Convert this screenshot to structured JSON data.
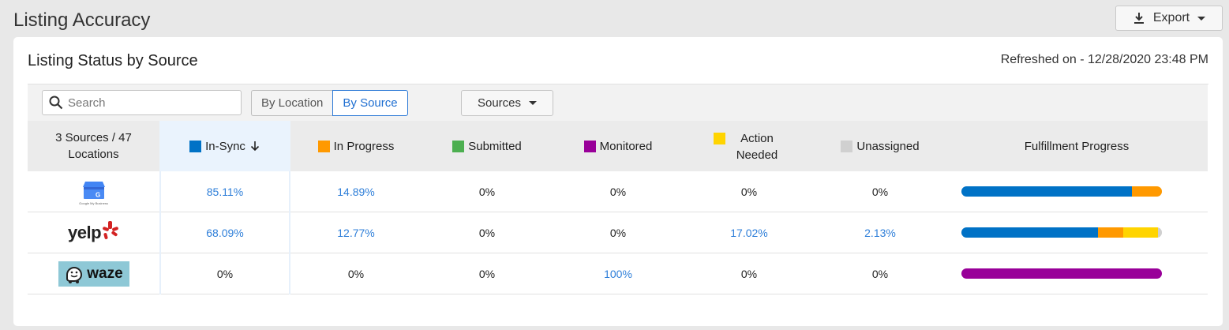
{
  "header": {
    "title": "Listing Accuracy",
    "export_label": "Export"
  },
  "card": {
    "title": "Listing Status by Source",
    "refreshed": "Refreshed on - 12/28/2020 23:48 PM"
  },
  "toolbar": {
    "search_placeholder": "Search",
    "toggle": {
      "by_location": "By Location",
      "by_source": "By Source",
      "active": "By Source"
    },
    "sources_label": "Sources"
  },
  "colors": {
    "in_sync": "#0072c6",
    "in_progress": "#ff9900",
    "submitted": "#4caf50",
    "monitored": "#990099",
    "action_needed": "#ffd400",
    "unassigned": "#d0d0d0",
    "link": "#2f7fd9"
  },
  "table": {
    "summary_label": "3 Sources / 47 Locations",
    "columns": {
      "in_sync": "In-Sync",
      "in_progress": "In Progress",
      "submitted": "Submitted",
      "monitored": "Monitored",
      "action_needed": "Action Needed",
      "unassigned": "Unassigned",
      "fulfillment": "Fulfillment Progress"
    },
    "sort": {
      "column": "In-Sync",
      "direction": "descending"
    },
    "rows": [
      {
        "source": "Google My Business",
        "logo_text": "Google My Business",
        "in_sync": "85.11%",
        "in_progress": "14.89%",
        "submitted": "0%",
        "monitored": "0%",
        "action_needed": "0%",
        "unassigned": "0%",
        "progress": {
          "in_sync": 85.11,
          "in_progress": 14.89,
          "submitted": 0,
          "monitored": 0,
          "action_needed": 0,
          "unassigned": 0
        }
      },
      {
        "source": "Yelp",
        "logo_text": "yelp",
        "in_sync": "68.09%",
        "in_progress": "12.77%",
        "submitted": "0%",
        "monitored": "0%",
        "action_needed": "17.02%",
        "unassigned": "2.13%",
        "progress": {
          "in_sync": 68.09,
          "in_progress": 12.77,
          "submitted": 0,
          "monitored": 0,
          "action_needed": 17.02,
          "unassigned": 2.13
        }
      },
      {
        "source": "Waze",
        "logo_text": "waze",
        "in_sync": "0%",
        "in_progress": "0%",
        "submitted": "0%",
        "monitored": "100%",
        "action_needed": "0%",
        "unassigned": "0%",
        "progress": {
          "in_sync": 0,
          "in_progress": 0,
          "submitted": 0,
          "monitored": 100,
          "action_needed": 0,
          "unassigned": 0
        }
      }
    ]
  }
}
